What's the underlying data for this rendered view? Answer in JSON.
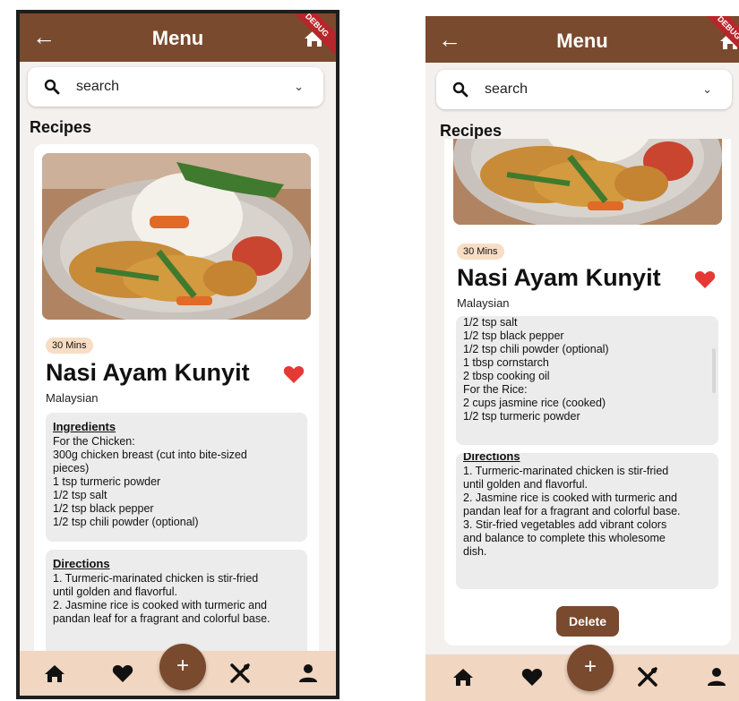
{
  "app_bar": {
    "title": "Menu",
    "debug_banner": "DEBUG",
    "back_icon": "arrow-left-icon",
    "home_icon": "home-icon"
  },
  "search": {
    "placeholder": "search",
    "icon": "search-icon",
    "dropdown_icon": "chevron-down-icon"
  },
  "section_title": "Recipes",
  "recipe": {
    "time_chip": "30 Mins",
    "name": "Nasi Ayam Kunyit",
    "cuisine": "Malaysian",
    "favorite": true,
    "ingredients_label": "Ingredients",
    "ingredients_lines_view1": [
      "For the Chicken:",
      "",
      "300g chicken breast (cut into bite-sized",
      "pieces)",
      "1 tsp turmeric powder",
      "1/2 tsp salt",
      "1/2 tsp black pepper",
      "1/2 tsp chili powder (optional)"
    ],
    "ingredients_lines_view2": [
      "1/2 tsp salt",
      "1/2 tsp black pepper",
      "1/2 tsp chili powder (optional)",
      "1 tbsp cornstarch",
      "2 tbsp cooking oil",
      "",
      "For the Rice:",
      "",
      "2 cups jasmine rice (cooked)",
      "1/2 tsp turmeric powder"
    ],
    "directions_label": "Directions",
    "directions_lines": [
      "1. Turmeric-marinated chicken is stir-fried",
      "until golden and flavorful.",
      "",
      "2. Jasmine rice is cooked with turmeric and",
      "pandan leaf for a fragrant and colorful base.",
      "",
      "3. Stir-fried vegetables add vibrant colors",
      "and balance to complete this wholesome",
      "dish."
    ],
    "delete_label": "Delete"
  },
  "bottom_nav": {
    "items": [
      "home-icon",
      "heart-icon",
      "cutlery-icon",
      "person-icon"
    ],
    "fab_label": "+"
  },
  "colors": {
    "brand_brown": "#7a4a2e",
    "chip_bg": "#f8ddc4",
    "heart_red": "#e53935",
    "nav_bg": "#f1d6c1",
    "debug_red": "#b7262a"
  }
}
